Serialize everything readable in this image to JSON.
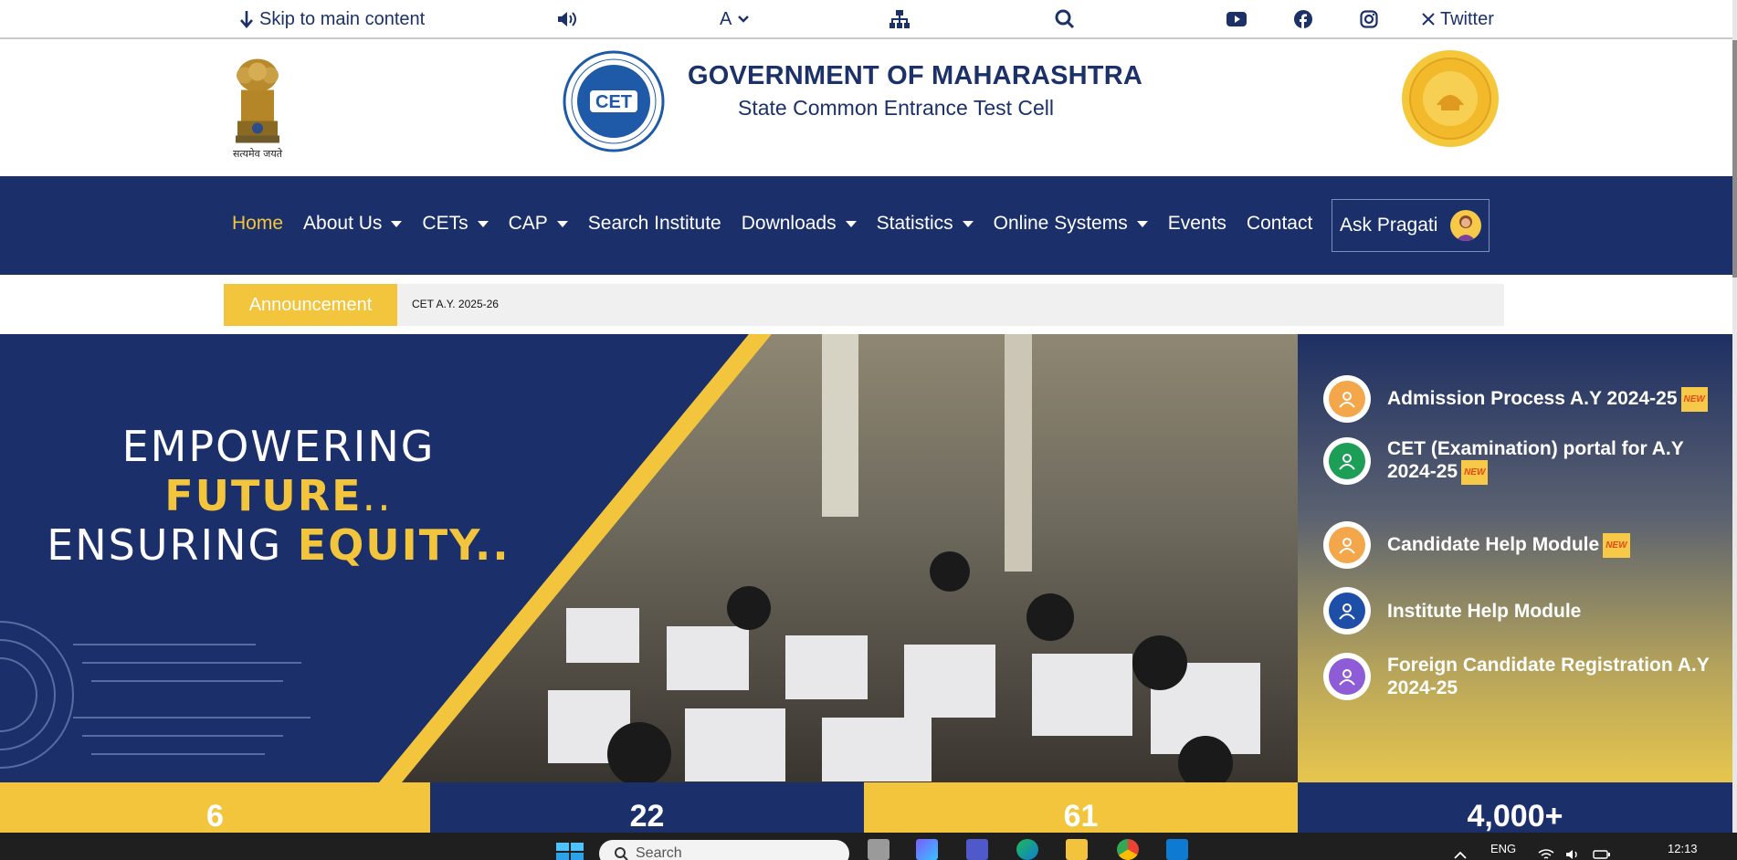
{
  "topbar": {
    "skip_label": "Skip to main content",
    "font_label": "A",
    "twitter_label": "Twitter"
  },
  "header": {
    "emblem_caption": "सत्यमेव जयते",
    "title": "GOVERNMENT OF MAHARASHTRA",
    "subtitle": "State Common Entrance Test Cell"
  },
  "nav": {
    "items": [
      {
        "label": "Home",
        "dropdown": false,
        "active": true
      },
      {
        "label": "About Us",
        "dropdown": true
      },
      {
        "label": "CETs",
        "dropdown": true
      },
      {
        "label": "CAP",
        "dropdown": true
      },
      {
        "label": "Search Institute",
        "dropdown": false
      },
      {
        "label": "Downloads",
        "dropdown": true
      },
      {
        "label": "Statistics",
        "dropdown": true
      },
      {
        "label": "Online Systems",
        "dropdown": true
      },
      {
        "label": "Events",
        "dropdown": false
      },
      {
        "label": "Contact",
        "dropdown": false
      }
    ],
    "ask_label": "Ask Pragati"
  },
  "announcement": {
    "label": "Announcement",
    "text": "CET A.Y. 2025-26"
  },
  "hero": {
    "line1": "EMPOWERING",
    "line2": "FUTURE",
    "line2_suffix": "..",
    "line3a": "ENSURING ",
    "line3b": "EQUITY.."
  },
  "side_links": [
    {
      "label": "Admission Process A.Y 2024-25",
      "new": true,
      "icon": "admission-icon",
      "color": "#f4a64a"
    },
    {
      "label": "CET (Examination) portal for A.Y 2024-25",
      "new": true,
      "icon": "exam-portal-icon",
      "color": "#1d9e57"
    },
    {
      "label": "Candidate Help Module",
      "new": true,
      "icon": "candidate-help-icon",
      "color": "#f4a64a"
    },
    {
      "label": "Institute Help Module",
      "new": false,
      "icon": "institute-icon",
      "color": "#1e4fa8"
    },
    {
      "label": "Foreign Candidate Registration A.Y 2024-25",
      "new": false,
      "icon": "foreign-registration-icon",
      "color": "#8d5cd6"
    }
  ],
  "new_badge": "NEW",
  "stats": [
    "6",
    "22",
    "61",
    "4,000+"
  ],
  "taskbar": {
    "search_placeholder": "Search",
    "lang": "ENG",
    "time": "12:13"
  },
  "colors": {
    "navy": "#1b2f6b",
    "gold": "#f2c53d"
  }
}
